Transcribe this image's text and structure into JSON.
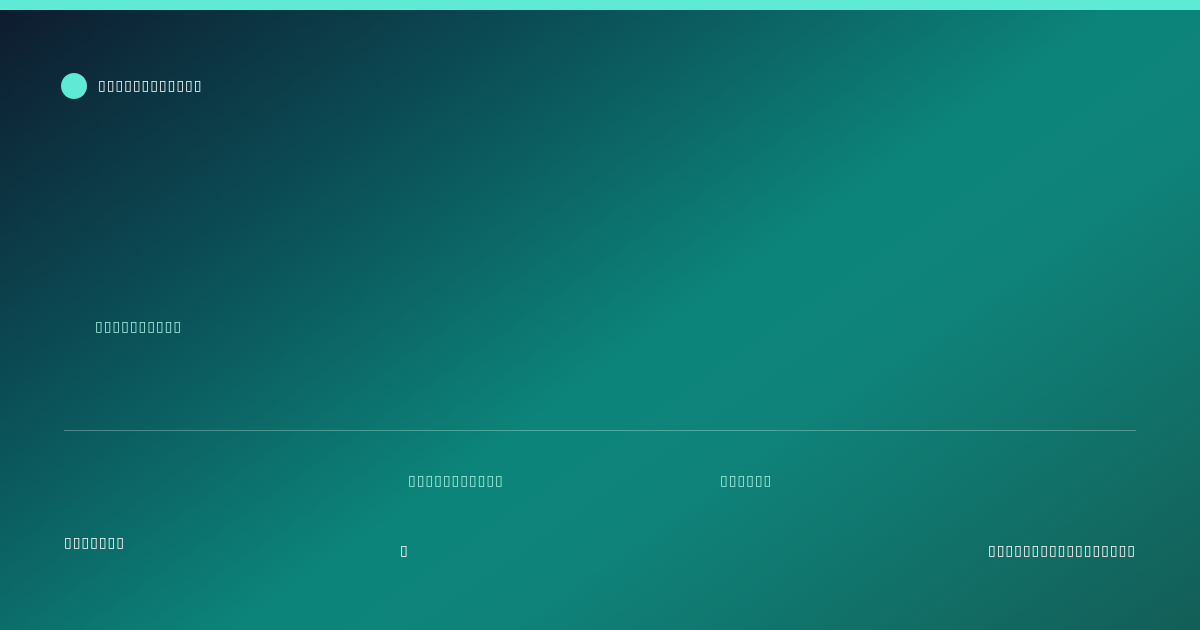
{
  "brand": {
    "name": "▯▯▯▯▯▯▯▯▯▯▯▯",
    "accent": "#5eead4"
  },
  "hero": {
    "headline": "▯▯▯▯▯▯▯▯▯▯"
  },
  "meta": {
    "label_one": "▯▯▯▯▯▯▯▯▯▯▯",
    "label_two": "▯▯▯▯▯▯"
  },
  "footer": {
    "left": "▯▯▯▯▯▯▯",
    "middle": "▯",
    "right": "▯▯▯▯▯▯▯▯▯▯▯▯▯▯▯▯▯"
  },
  "colors": {
    "accent": "#5eead4",
    "text": "#ffffff",
    "muted_text": "#a7f3e6"
  }
}
